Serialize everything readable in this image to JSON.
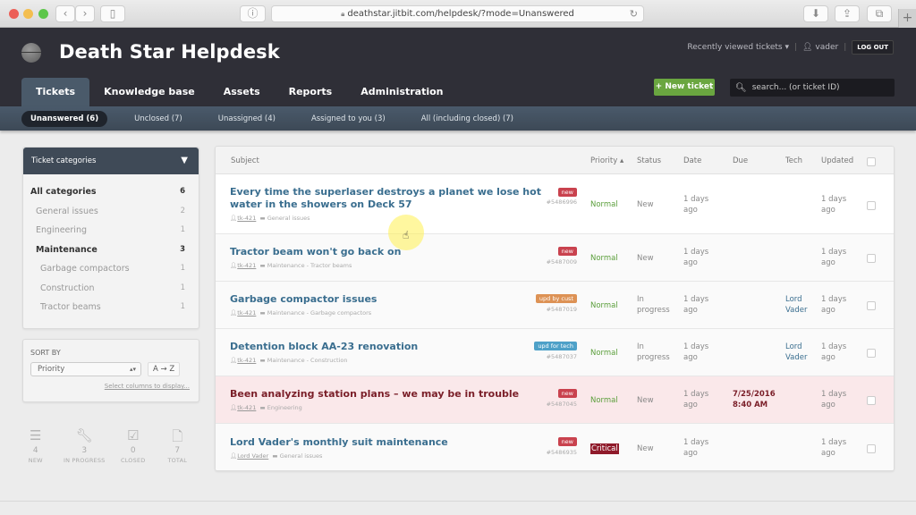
{
  "browser": {
    "url": "deathstar.jitbit.com/helpdesk/?mode=Unanswered"
  },
  "header": {
    "title": "Death Star Helpdesk",
    "recently_viewed": "Recently viewed tickets",
    "username": "vader",
    "logout": "LOG OUT",
    "new_ticket": "+ New ticket",
    "search_placeholder": "search... (or ticket ID)"
  },
  "tabs": [
    "Tickets",
    "Knowledge base",
    "Assets",
    "Reports",
    "Administration"
  ],
  "subtabs": [
    "Unanswered (6)",
    "Unclosed (7)",
    "Unassigned (4)",
    "Assigned to you (3)",
    "All (including closed) (7)"
  ],
  "sidebar": {
    "categories_title": "Ticket categories",
    "categories": [
      {
        "label": "All categories",
        "count": "6"
      },
      {
        "label": "General issues",
        "count": "2"
      },
      {
        "label": "Engineering",
        "count": "1"
      },
      {
        "label": "Maintenance",
        "count": "3"
      },
      {
        "label": "Garbage compactors",
        "count": "1"
      },
      {
        "label": "Construction",
        "count": "1"
      },
      {
        "label": "Tractor beams",
        "count": "1"
      }
    ],
    "sort_label": "SORT BY",
    "sort_value": "Priority",
    "sort_dir": "A → Z",
    "select_columns": "Select columns to display..."
  },
  "stats": [
    {
      "value": "4",
      "label": "NEW"
    },
    {
      "value": "3",
      "label": "IN PROGRESS"
    },
    {
      "value": "0",
      "label": "CLOSED"
    },
    {
      "value": "7",
      "label": "TOTAL"
    }
  ],
  "table": {
    "columns": {
      "subject": "Subject",
      "priority": "Priority ▴",
      "status": "Status",
      "date": "Date",
      "due": "Due",
      "tech": "Tech",
      "updated": "Updated"
    },
    "rows": [
      {
        "subject": "Every time the superlaser destroys a planet we lose hot water in the showers on Deck 57",
        "user": "tk-421",
        "category": "General issues",
        "badge": "new",
        "id": "#5486996",
        "priority": "Normal",
        "status": "New",
        "date": "1 days ago",
        "due": "",
        "tech": "",
        "updated": "1 days ago"
      },
      {
        "subject": "Tractor beam won't go back on",
        "user": "tk-421",
        "category": "Maintenance - Tractor beams",
        "badge": "new",
        "id": "#5487009",
        "priority": "Normal",
        "status": "New",
        "date": "1 days ago",
        "due": "",
        "tech": "",
        "updated": "1 days ago"
      },
      {
        "subject": "Garbage compactor issues",
        "user": "tk-421",
        "category": "Maintenance - Garbage compactors",
        "badge": "upd by cust",
        "id": "#5487019",
        "priority": "Normal",
        "status": "In progress",
        "date": "1 days ago",
        "due": "",
        "tech": "Lord Vader",
        "updated": "1 days ago"
      },
      {
        "subject": "Detention block AA-23 renovation",
        "user": "tk-421",
        "category": "Maintenance - Construction",
        "badge": "upd for tech",
        "id": "#5487037",
        "priority": "Normal",
        "status": "In progress",
        "date": "1 days ago",
        "due": "",
        "tech": "Lord Vader",
        "updated": "1 days ago"
      },
      {
        "subject": "Been analyzing station plans – we may be in trouble",
        "user": "tk-421",
        "category": "Engineering",
        "badge": "new",
        "id": "#5487045",
        "priority": "Normal",
        "status": "New",
        "date": "1 days ago",
        "due": "7/25/2016 8:40 AM",
        "tech": "",
        "updated": "1 days ago"
      },
      {
        "subject": "Lord Vader's monthly suit maintenance",
        "user": "Lord Vader",
        "category": "General issues",
        "badge": "new",
        "id": "#5486935",
        "priority": "Critical",
        "status": "New",
        "date": "1 days ago",
        "due": "",
        "tech": "",
        "updated": "1 days ago"
      }
    ]
  },
  "colors": {
    "header_bg": "#2f2f37",
    "accent_green": "#6aa640",
    "link_blue": "#3a6e8f",
    "badge_new": "#c9424e",
    "critical": "#8f1a2a"
  }
}
